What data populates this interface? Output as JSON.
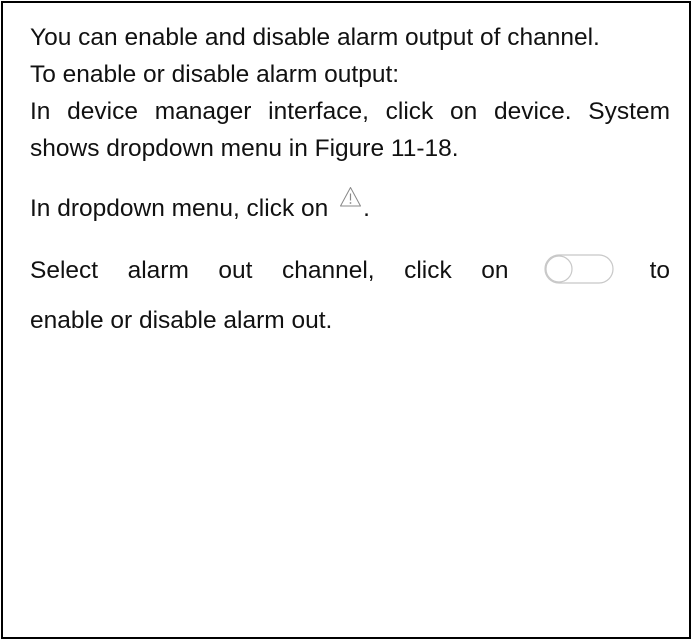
{
  "document": {
    "paragraphs": {
      "intro": "You can enable and disable alarm output of channel.",
      "heading": "To enable or disable alarm output:",
      "step1": "In device manager interface, click on device. System shows dropdown menu in Figure 11-18.",
      "step2_before": "In dropdown menu, click on",
      "step2_after": ".",
      "step3_before": "Select alarm out channel, click on",
      "step3_after_icon": "to",
      "step3_end": "enable or disable alarm out."
    },
    "icons": {
      "warning": "warning-triangle-icon",
      "toggle": "toggle-switch-off-icon"
    },
    "colors": {
      "icon_stroke": "#888888",
      "toggle_track_border": "#c8c8c8",
      "toggle_knob": "#ffffff"
    }
  }
}
